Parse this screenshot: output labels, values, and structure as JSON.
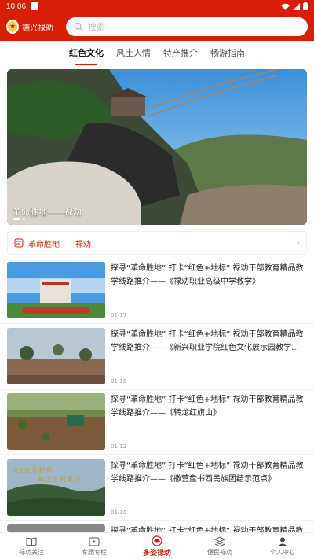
{
  "status_bar": {
    "time": "10:06",
    "notification_badge": "禄劝"
  },
  "header": {
    "logo_text": "德兴禄劝",
    "search_placeholder": "搜索"
  },
  "tabs": [
    {
      "label": "红色文化",
      "active": true
    },
    {
      "label": "风土人情",
      "active": false
    },
    {
      "label": "特产推介",
      "active": false
    },
    {
      "label": "畅游指南",
      "active": false
    }
  ],
  "banner": {
    "caption": "革命胜地——禄劝"
  },
  "notice": {
    "text": "革命胜地——禄劝"
  },
  "articles": [
    {
      "title": "探寻“革命胜地” 打卡“红色+地标” 禄劝干部教育精品教学线路推介——《禄劝职业高级中学教学》",
      "date": "01-17"
    },
    {
      "title": "探寻“革命胜地” 打卡“红色+地标” 禄劝干部教育精品教学线路推介——《新兴职业学院红色文化展示园教学…",
      "date": "01-15"
    },
    {
      "title": "探寻“革命胜地” 打卡“红色+地标” 禄劝干部教育精品教学线路推介——《转龙红旗山》",
      "date": "01-12"
    },
    {
      "title": "探寻“革命胜地” 打卡“红色+地标” 禄劝干部教育精品教学线路推介——《撒营盘书西民族团结示范点》",
      "date": "01-10"
    },
    {
      "title": "探寻“革命胜地” 打卡“红色+地标” 禄劝干部教育精品教学线路推介",
      "date": ""
    }
  ],
  "thumb4_overlay": {
    "line1": "文化宣 引 村 领",
    "line2": "助 力 乡 村 振 兴"
  },
  "bottom_nav": [
    {
      "label": "禄劝关注",
      "icon": "book-icon",
      "active": false
    },
    {
      "label": "专题专栏",
      "icon": "video-icon",
      "active": false
    },
    {
      "label": "多姿禄劝",
      "icon": "flower-icon",
      "active": true
    },
    {
      "label": "便民禄劝",
      "icon": "layers-icon",
      "active": false
    },
    {
      "label": "个人中心",
      "icon": "person-icon",
      "active": false
    }
  ],
  "colors": {
    "brand_red": "#d81e06",
    "text_dark": "#222222",
    "date_gray": "#999999"
  }
}
